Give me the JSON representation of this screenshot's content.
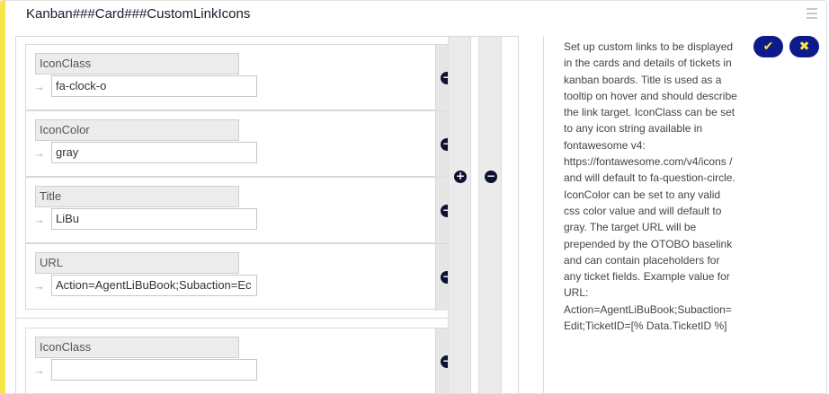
{
  "setting": {
    "title": "Kanban###Card###CustomLinkIcons"
  },
  "icons": {
    "remove_glyph": "−",
    "add_glyph": "+",
    "arrow_glyph": "→",
    "save_glyph": "✔",
    "cancel_glyph": "✖"
  },
  "entries": [
    {
      "fields": [
        {
          "label": "IconClass",
          "value": "fa-clock-o"
        },
        {
          "label": "IconColor",
          "value": "gray"
        },
        {
          "label": "Title",
          "value": "LiBu"
        },
        {
          "label": "URL",
          "value": "Action=AgentLiBuBook;Subaction=Ec"
        }
      ]
    },
    {
      "fields": [
        {
          "label": "IconClass",
          "value": ""
        }
      ]
    }
  ],
  "description": "Set up custom links to be displayed in the cards and details of tickets in kanban boards. Title is used as a tooltip on hover and should describe the link target. IconClass can be set to any icon string available in fontawesome v4: https://fontawesome.com/v4/icons / and will default to fa-question-circle. IconColor can be set to any valid css color value and will default to gray. The target URL will be prepended by the OTOBO baselink and can contain placeholders for any ticket fields. Example value for URL: Action=AgentLiBuBook;Subaction=Edit;TicketID=[% Data.TicketID %]",
  "colors": {
    "accent_yellow": "#f7e64a",
    "button_navy": "#0d1a8a"
  }
}
